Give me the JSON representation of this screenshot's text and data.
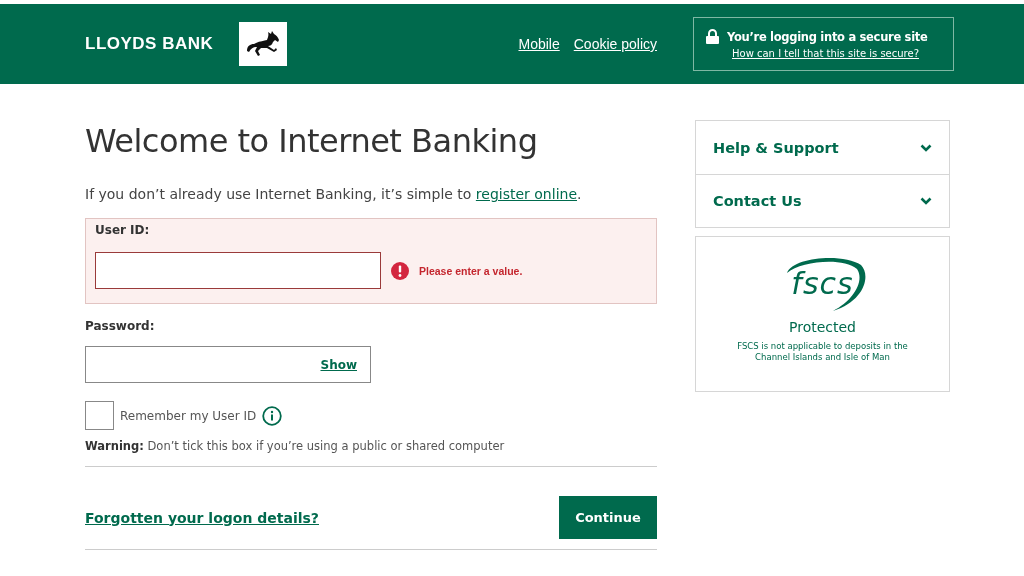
{
  "header": {
    "brand": "LLOYDS BANK",
    "nav_links": [
      "Mobile",
      "Cookie policy"
    ],
    "secure_notice": {
      "title": "You’re logging into a secure site",
      "link": "How can I tell that this site is secure?"
    }
  },
  "main": {
    "title": "Welcome to Internet Banking",
    "intro": "If you don’t already use Internet Banking, it’s simple to ",
    "intro_link": "register online",
    "intro_end": ".",
    "user_id": {
      "label": "User ID:",
      "invalid": true,
      "error": "Please enter a value."
    },
    "password": {
      "label": "Password:",
      "show_link": "Show"
    },
    "remember": {
      "label": "Remember my User ID",
      "checked": false
    },
    "warning": "**Warning:** Don’t tick this box if you’re using a public or shared computer",
    "forgot_link": "Forgotten your logon details?",
    "continue_button": "Continue"
  },
  "sidebar": {
    "accordion": [
      {
        "label": "Help & Support",
        "expanded": false
      },
      {
        "label": "Contact Us",
        "expanded": false
      }
    ],
    "fscs": {
      "logo": "fscs",
      "title": "Protected",
      "note": "FSCS is not applicable to deposits in the Channel Islands and Isle of Man"
    }
  }
}
